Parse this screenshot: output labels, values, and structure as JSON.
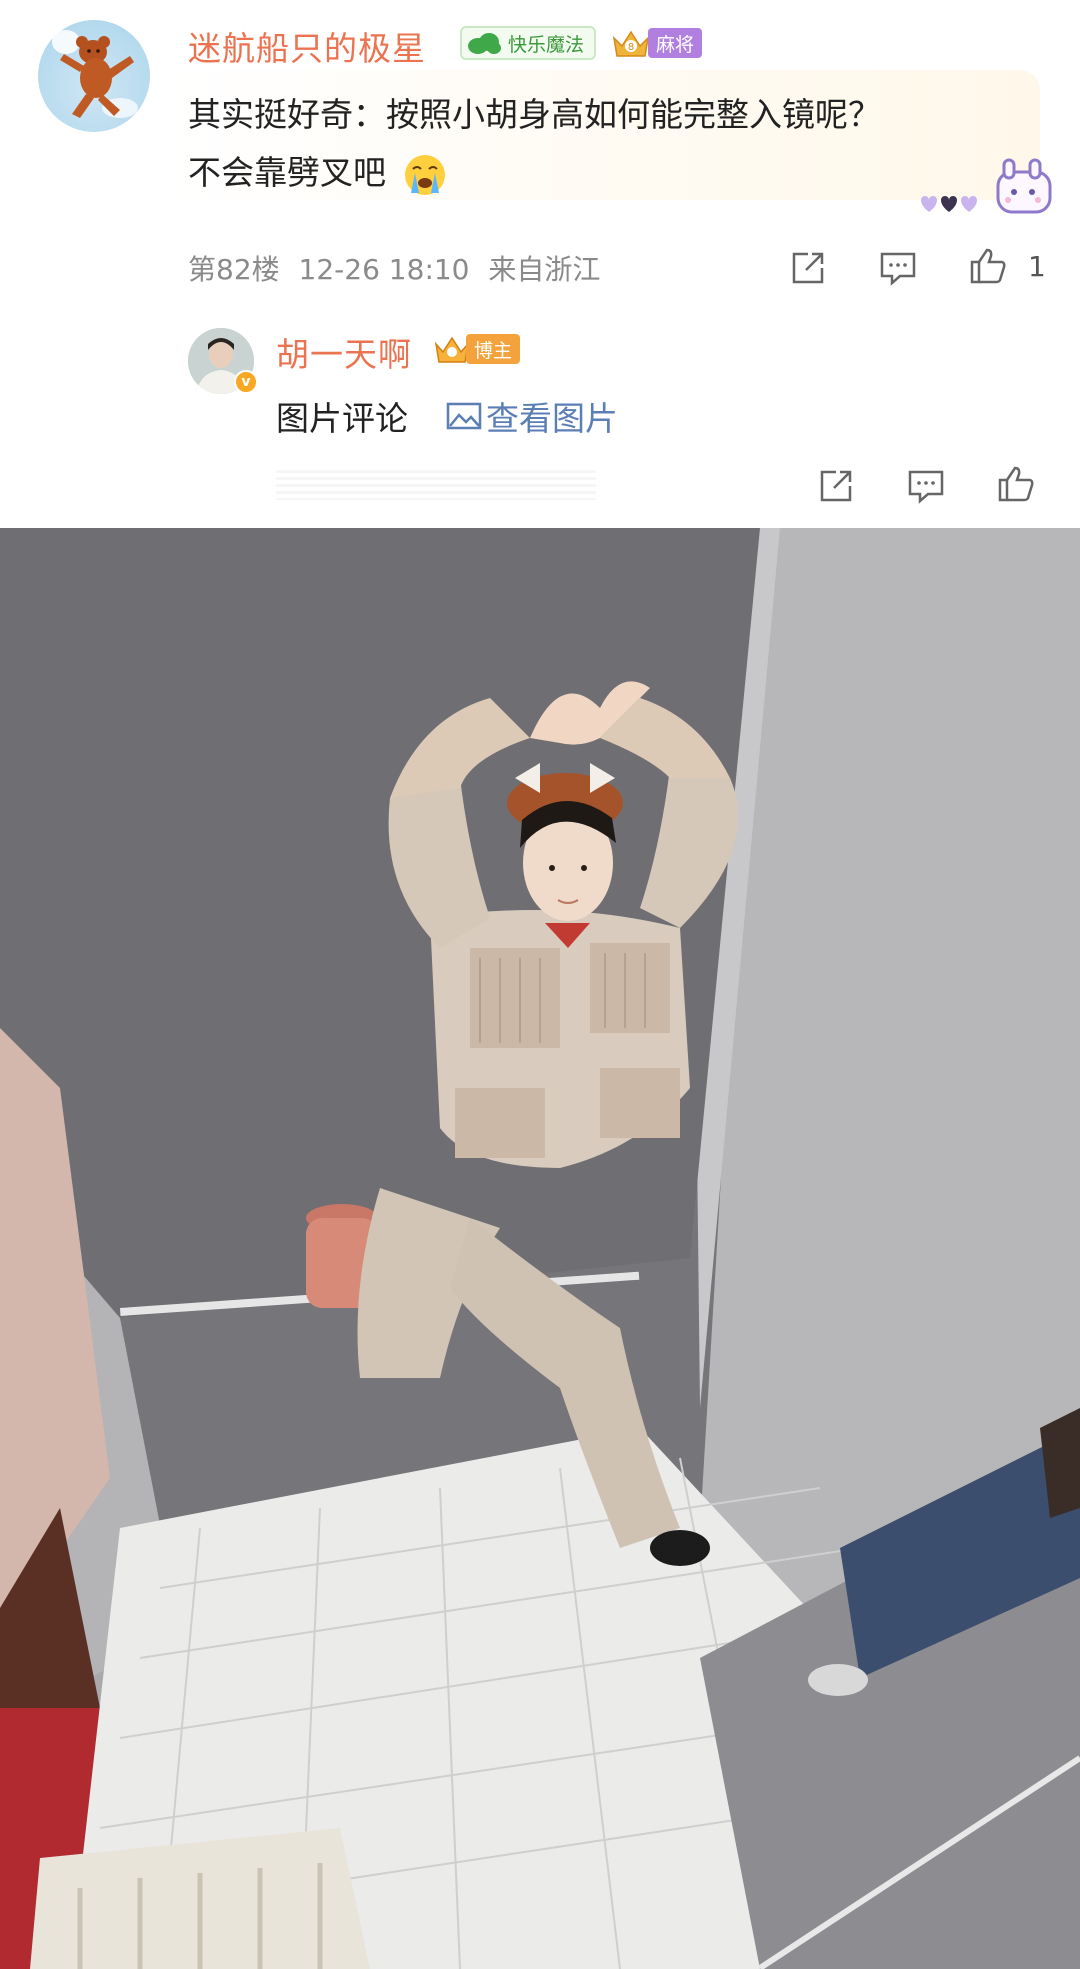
{
  "comment": {
    "username": "迷航船只的极星",
    "badge_magic": "快乐魔法",
    "badge_mahjong": "麻将",
    "text_line1": "其实挺好奇：按照小胡身高如何能完整入镜呢？",
    "text_line2": "不会靠劈叉吧",
    "floor": "第82楼",
    "date": "12-26 18:10",
    "location": "来自浙江",
    "like_count": "1",
    "icons": [
      "share-icon",
      "comment-icon",
      "like-icon",
      "crying-emoji-icon",
      "bunny-sticker-icon"
    ]
  },
  "reply": {
    "username": "胡一天啊",
    "badge_host": "博主",
    "verified_mark": "v",
    "text": "图片评论",
    "link_text": "查看图片",
    "icons": [
      "share-icon",
      "comment-icon",
      "like-icon",
      "image-icon"
    ]
  },
  "colors": {
    "username": "#eb7350",
    "link": "#5b7fb5",
    "meta": "#8a8a8a",
    "mahjong_badge": "#b07fe0",
    "host_badge": "#f4a23c"
  }
}
